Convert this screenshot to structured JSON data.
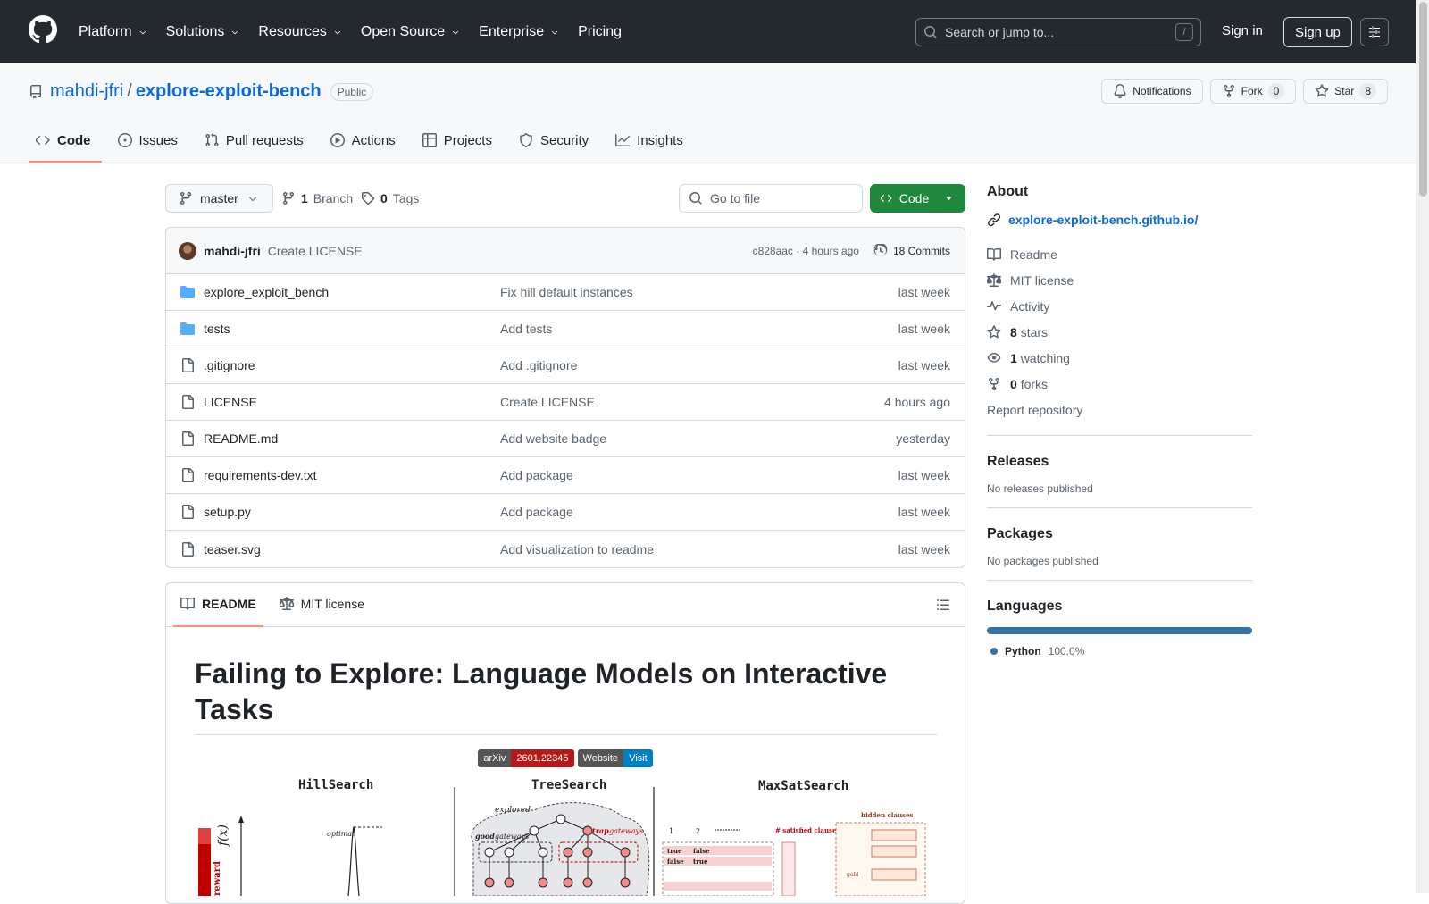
{
  "header": {
    "nav": [
      {
        "label": "Platform",
        "dropdown": true
      },
      {
        "label": "Solutions",
        "dropdown": true
      },
      {
        "label": "Resources",
        "dropdown": true
      },
      {
        "label": "Open Source",
        "dropdown": true
      },
      {
        "label": "Enterprise",
        "dropdown": true
      },
      {
        "label": "Pricing",
        "dropdown": false
      }
    ],
    "search_placeholder": "Search or jump to...",
    "search_shortcut": "/",
    "sign_in": "Sign in",
    "sign_up": "Sign up"
  },
  "repo": {
    "owner": "mahdi-jfri",
    "separator": "/",
    "name": "explore-exploit-bench",
    "visibility": "Public",
    "notifications_label": "Notifications",
    "fork_label": "Fork",
    "fork_count": "0",
    "star_label": "Star",
    "star_count": "8",
    "tabs": [
      {
        "label": "Code",
        "icon": "code-icon",
        "active": true
      },
      {
        "label": "Issues",
        "icon": "issue-icon",
        "active": false
      },
      {
        "label": "Pull requests",
        "icon": "pull-request-icon",
        "active": false
      },
      {
        "label": "Actions",
        "icon": "play-icon",
        "active": false
      },
      {
        "label": "Projects",
        "icon": "table-icon",
        "active": false
      },
      {
        "label": "Security",
        "icon": "shield-icon",
        "active": false
      },
      {
        "label": "Insights",
        "icon": "graph-icon",
        "active": false
      }
    ]
  },
  "file_nav": {
    "branch": "master",
    "branch_count": "1",
    "branch_label": "Branch",
    "tag_count": "0",
    "tag_label": "Tags",
    "goto_placeholder": "Go to file",
    "code_button": "Code"
  },
  "latest_commit": {
    "author": "mahdi-jfri",
    "message": "Create LICENSE",
    "hash_time": "c828aac · 4 hours ago",
    "commits_label": "18 Commits"
  },
  "files": [
    {
      "type": "folder",
      "name": "explore_exploit_bench",
      "commit": "Fix hill default instances",
      "time": "last week"
    },
    {
      "type": "folder",
      "name": "tests",
      "commit": "Add tests",
      "time": "last week"
    },
    {
      "type": "file",
      "name": ".gitignore",
      "commit": "Add .gitignore",
      "time": "last week"
    },
    {
      "type": "file",
      "name": "LICENSE",
      "commit": "Create LICENSE",
      "time": "4 hours ago"
    },
    {
      "type": "file",
      "name": "README.md",
      "commit": "Add website badge",
      "time": "yesterday"
    },
    {
      "type": "file",
      "name": "requirements-dev.txt",
      "commit": "Add package",
      "time": "last week"
    },
    {
      "type": "file",
      "name": "setup.py",
      "commit": "Add package",
      "time": "last week"
    },
    {
      "type": "file",
      "name": "teaser.svg",
      "commit": "Add visualization to readme",
      "time": "last week"
    }
  ],
  "readme": {
    "tab_readme": "README",
    "tab_license": "MIT license",
    "title": "Failing to Explore: Language Models on Interactive Tasks",
    "badge_arxiv_left": "arXiv",
    "badge_arxiv_right": "2601.22345",
    "badge_web_left": "Website",
    "badge_web_right": "Visit",
    "figure": {
      "hill_title": "HillSearch",
      "tree_title": "TreeSearch",
      "maxsat_title": "MaxSatSearch",
      "fx_label": "f(x)",
      "optimal_label": "optimal",
      "reward_label": "reward",
      "explored_label": "explored",
      "good_label": "good",
      "good_gateways_label": "gateways",
      "trap_label": "trap",
      "trap_gateways_label": "gateways",
      "satisfied_label": "# satisfied clauses",
      "hidden_label": "hidden clauses",
      "gold_label": "gold",
      "true_label": "true",
      "false_label": "false",
      "var1_label": "1",
      "var2_label": "2"
    }
  },
  "sidebar": {
    "about_title": "About",
    "website": "explore-exploit-bench.github.io/",
    "items": [
      {
        "icon": "book-icon",
        "bold": "",
        "text": "Readme"
      },
      {
        "icon": "law-icon",
        "bold": "",
        "text": "MIT license"
      },
      {
        "icon": "pulse-icon",
        "bold": "",
        "text": "Activity"
      },
      {
        "icon": "star-icon",
        "bold": "8",
        "text": "stars"
      },
      {
        "icon": "eye-icon",
        "bold": "1",
        "text": "watching"
      },
      {
        "icon": "fork-icon",
        "bold": "0",
        "text": "forks"
      }
    ],
    "report": "Report repository",
    "releases_title": "Releases",
    "releases_text": "No releases published",
    "packages_title": "Packages",
    "packages_text": "No packages published",
    "languages_title": "Languages",
    "language_name": "Python",
    "language_pct": "100.0%",
    "language_share": 1.0,
    "language_color": "#3572a5"
  },
  "colors": {
    "header_bg": "#24292f",
    "link": "#0969da",
    "primary_button": "#1f883d",
    "tab_underline": "#fd8c73"
  }
}
